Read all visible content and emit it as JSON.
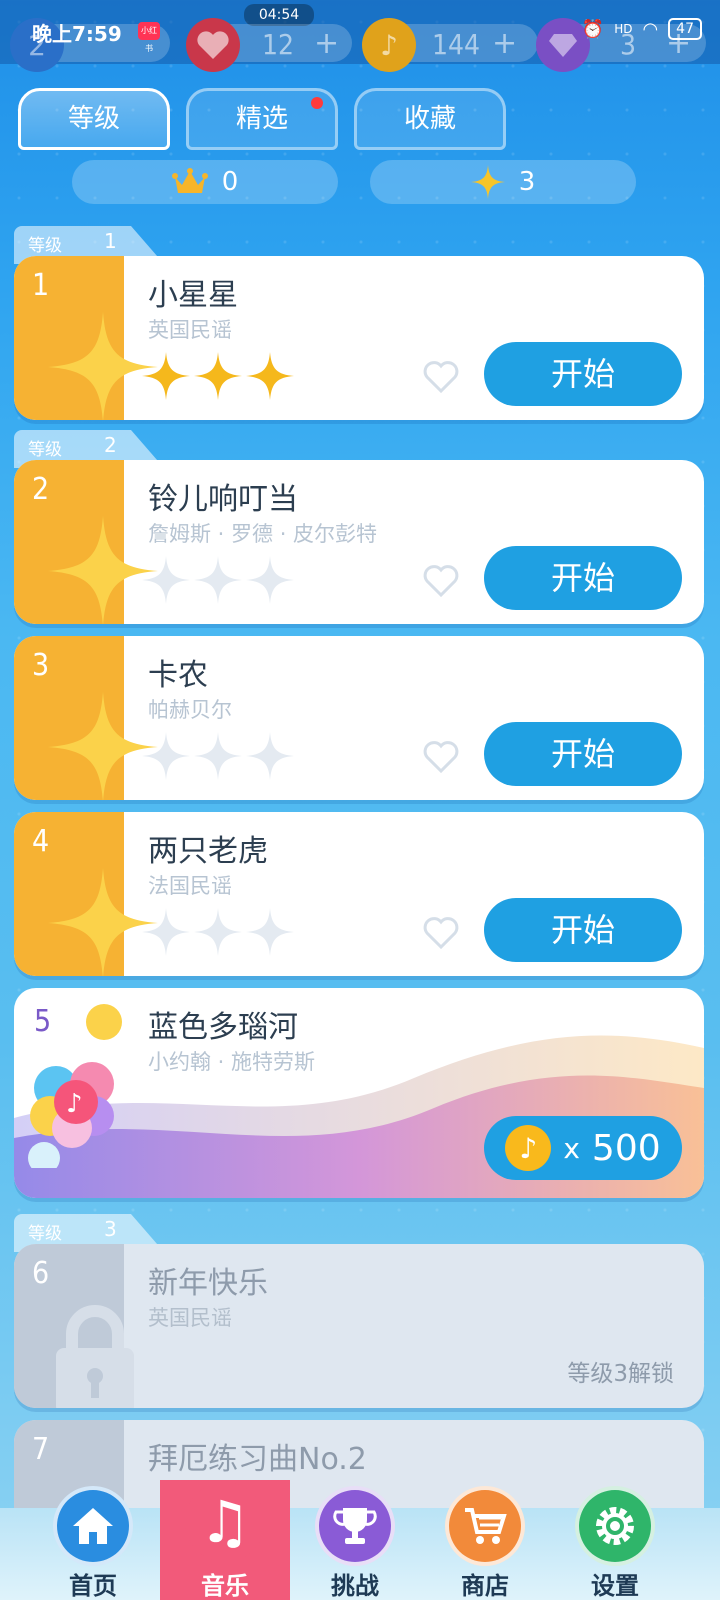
{
  "status_bar": {
    "time": "晚上7:59",
    "center_clock": "04:54",
    "app_badge": "小红书",
    "battery": "47",
    "hd": "HD"
  },
  "resources": {
    "level": "2",
    "lives": "12",
    "notes": "144",
    "gems": "3",
    "plus": "+"
  },
  "tabs": [
    {
      "label": "等级",
      "active": true
    },
    {
      "label": "精选",
      "active": false,
      "has_dot": true
    },
    {
      "label": "收藏",
      "active": false
    }
  ],
  "stats": {
    "crowns": "0",
    "stars": "3"
  },
  "level_label": "等级",
  "levels": [
    {
      "num": "1"
    },
    {
      "num": "2"
    },
    {
      "num": "3"
    }
  ],
  "songs": [
    {
      "rank": "1",
      "title": "小星星",
      "artist": "英国民谣",
      "stars": 3,
      "button": "开始"
    },
    {
      "rank": "2",
      "title": "铃儿响叮当",
      "artist": "詹姆斯 · 罗德 · 皮尔彭特",
      "stars": 0,
      "button": "开始"
    },
    {
      "rank": "3",
      "title": "卡农",
      "artist": "帕赫贝尔",
      "stars": 0,
      "button": "开始"
    },
    {
      "rank": "4",
      "title": "两只老虎",
      "artist": "法国民谣",
      "stars": 0,
      "button": "开始"
    },
    {
      "rank": "5",
      "title": "蓝色多瑙河",
      "artist": "小约翰 · 施特劳斯",
      "price_prefix": "x",
      "price": "500"
    },
    {
      "rank": "6",
      "title": "新年快乐",
      "artist": "英国民谣",
      "unlock": "等级3解锁"
    },
    {
      "rank": "7",
      "title": "拜厄练习曲No.2"
    }
  ],
  "nav": [
    {
      "label": "首页",
      "icon": "home-icon",
      "color": "#2a8de0"
    },
    {
      "label": "音乐",
      "icon": "music-note-icon",
      "color": "#f25a7a",
      "active": true
    },
    {
      "label": "挑战",
      "icon": "trophy-icon",
      "color": "#8a5bd6"
    },
    {
      "label": "商店",
      "icon": "cart-icon",
      "color": "#f28a3a"
    },
    {
      "label": "设置",
      "icon": "gear-icon",
      "color": "#2fb56a"
    }
  ],
  "colors": {
    "accent": "#1fa0e2",
    "gold": "#f6b233",
    "active_nav": "#f25a7a"
  }
}
